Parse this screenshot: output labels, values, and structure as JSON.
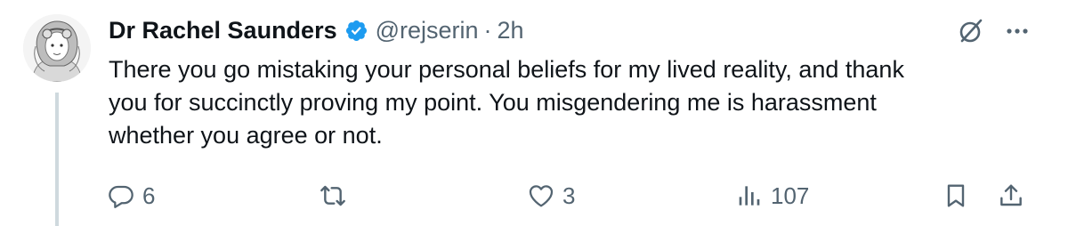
{
  "author": {
    "display_name": "Dr Rachel Saunders",
    "handle": "@rejserin",
    "separator": "·",
    "time": "2h",
    "verified": true
  },
  "tweet": {
    "text": "There you go mistaking your personal beliefs for my lived reality, and thank\nyou for succinctly proving my point. You misgendering me is harassment\nwhether you agree or not."
  },
  "actions": {
    "reply_count": "6",
    "retweet_count": "",
    "like_count": "3",
    "view_count": "107"
  },
  "icons": {
    "avatar": "avatar-illustration",
    "verified": "verified-badge-icon",
    "grok": "grok-icon",
    "more": "more-icon",
    "reply": "reply-icon",
    "retweet": "retweet-icon",
    "like": "heart-icon",
    "views": "views-icon",
    "bookmark": "bookmark-icon",
    "share": "share-icon"
  },
  "colors": {
    "text": "#0f1419",
    "secondary": "#536471",
    "verified_blue": "#1d9bf0",
    "thread_line": "#cfd9de"
  }
}
